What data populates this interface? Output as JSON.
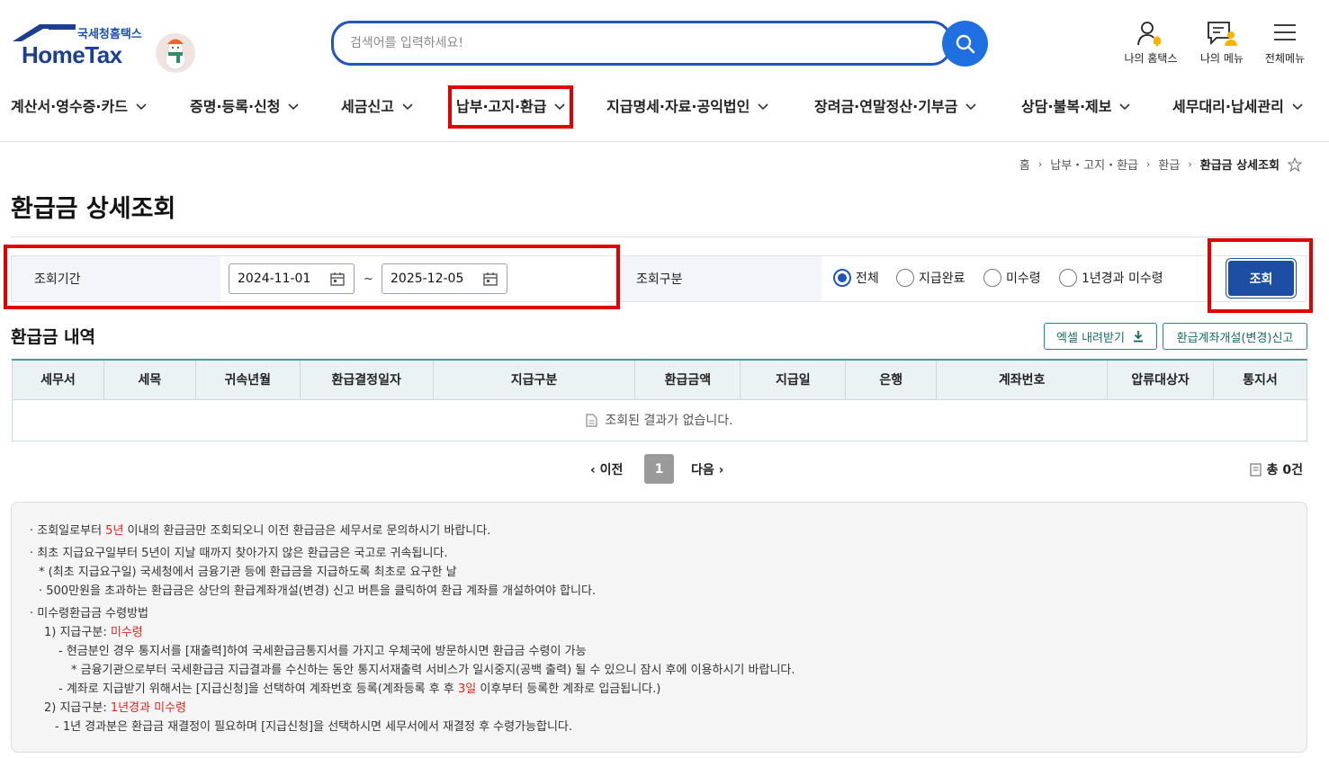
{
  "header": {
    "logo_sub": "국세청홈택스",
    "logo_main": "HomeTax",
    "search_placeholder": "검색어를 입력하세요!",
    "utils": [
      "나의 홈택스",
      "나의 메뉴",
      "전체메뉴"
    ]
  },
  "nav": [
    "계산서·영수증·카드",
    "증명·등록·신청",
    "세금신고",
    "납부·고지·환급",
    "지급명세·자료·공익법인",
    "장려금·연말정산·기부금",
    "상담·불복·제보",
    "세무대리·납세관리"
  ],
  "breadcrumb": [
    "홈",
    "납부・고지・환급",
    "환급",
    "환급금 상세조회"
  ],
  "page_title": "환급금 상세조회",
  "search_panel": {
    "period_label": "조회기간",
    "date_from": "2024-11-01",
    "date_sep": "~",
    "date_to": "2025-12-05",
    "type_label": "조회구분",
    "radios": [
      "전체",
      "지급완료",
      "미수령",
      "1년경과 미수령"
    ],
    "selected_radio": "전체",
    "query_button": "조회"
  },
  "section": {
    "title": "환급금 내역",
    "excel_button": "엑셀 내려받기",
    "account_button": "환급계좌개설(변경)신고"
  },
  "table": {
    "headers": [
      "세무서",
      "세목",
      "귀속년월",
      "환급결정일자",
      "지급구분",
      "환급금액",
      "지급일",
      "은행",
      "계좌번호",
      "압류대상자",
      "통지서"
    ],
    "empty_message": "조회된 결과가 없습니다."
  },
  "paging": {
    "prev": "이전",
    "current": "1",
    "next": "다음",
    "total": "총 0건"
  },
  "notice": {
    "l1a": "조회일로부터 ",
    "l1b": "5년",
    "l1c": " 이내의 환급금만 조회되오니 이전 환급금은 세무서로 문의하시기 바랍니다.",
    "l2": "최초 지급요구일부터 5년이 지날 때까지 찾아가지 않은 환급금은 국고로 귀속됩니다.",
    "l3": "* (최초 지급요구일) 국세청에서 금융기관 등에 환급금을 지급하도록 최초로 요구한 날",
    "l4": "· 500만원을 초과하는 환급금은 상단의 환급계좌개설(변경) 신고 버튼을 클릭하여 환급 계좌를 개설하여야 합니다.",
    "l5": "미수령환급금 수령방법",
    "l6a": "1) 지급구분: ",
    "l6b": "미수령",
    "l7": "- 현금분인 경우 통지서를 [재출력]하여 국세환급금통지서를 가지고 우체국에 방문하시면 환급금 수령이 가능",
    "l8": "* 금융기관으로부터 국세환급금 지급결과를 수신하는 동안 통지서재출력 서비스가 일시중지(공백 출력) 될 수 있으니 잠시 후에 이용하시기 바랍니다.",
    "l9a": "- 계좌로 지급받기 위해서는 [지급신청]을 선택하여 계좌번호 등록(계좌등록 후 후 ",
    "l9b": "3일",
    "l9c": " 이후부터 등록한 계좌로 입금됩니다.)",
    "l10a": "2) 지급구분: ",
    "l10b": "1년경과 미수령",
    "l11": "- 1년 경과분은 환급금 재결정이 필요하며 [지급신청]을 선택하시면 세무서에서 재결정 후 수령가능합니다."
  },
  "colors": {
    "accent": "#1f56b8",
    "highlight": "#e00000",
    "teal": "#4b9a97",
    "red_text": "#e0261d"
  }
}
